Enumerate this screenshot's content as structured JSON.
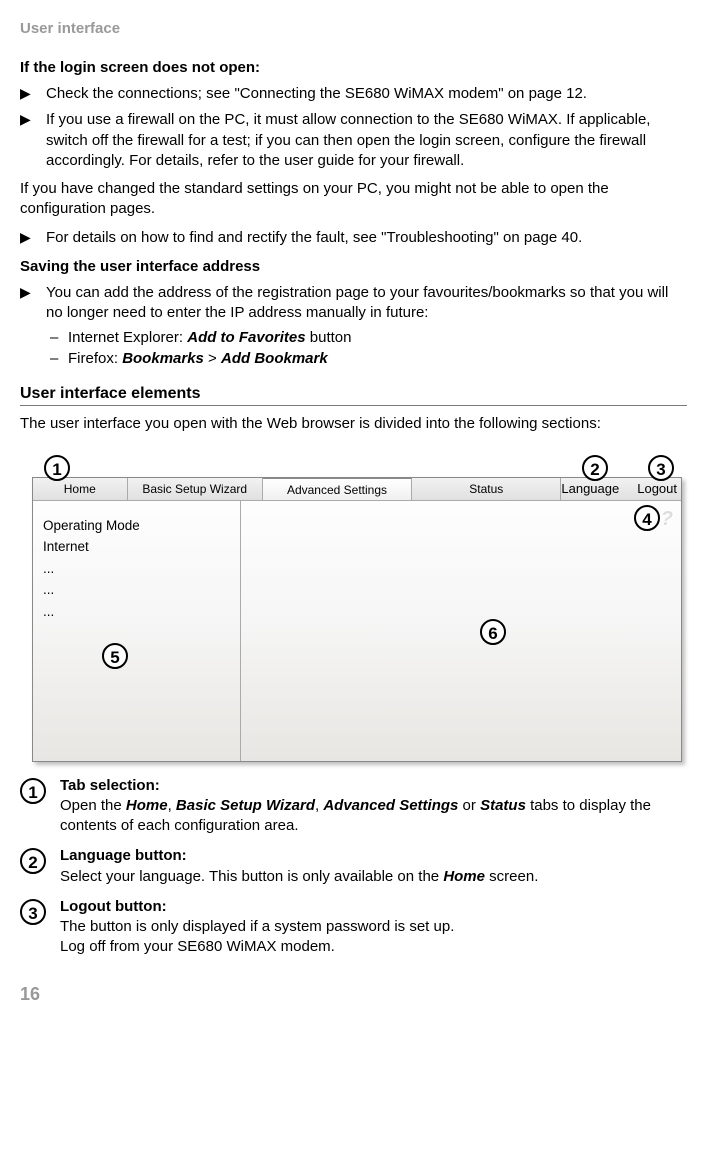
{
  "header_label": "User interface",
  "sec1_title": "If the login screen does not open:",
  "b1": "Check the connections; see \"Connecting the SE680 WiMAX modem\" on page 12.",
  "b2": "If you use a firewall on the PC, it must allow connection to the SE680 WiMAX. If applicable, switch off the firewall for a test; if you can then open the login screen, configure the firewall accordingly. For details, refer to the user guide for your firewall.",
  "p1": "If you have changed the standard settings on your PC, you might not be able to open the configuration pages.",
  "b3": "For details on how to find and rectify the fault, see \"Troubleshooting\" on page 40.",
  "sec2_title": "Saving the user interface address",
  "b4": "You can add the address of the registration page to your favourites/bookmarks so that you will no longer need to enter the IP address manually in future:",
  "d1_pre": "Internet Explorer: ",
  "d1_em": "Add to Favorites",
  "d1_post": " button",
  "d2_pre": "Firefox: ",
  "d2_em1": "Bookmarks",
  "d2_mid": " > ",
  "d2_em2": "Add Bookmark",
  "h2": "User interface elements",
  "p2": "The user interface you open with the Web browser is divided into the following sections:",
  "diagram": {
    "tabs": {
      "home": "Home",
      "wizard": "Basic Setup Wizard",
      "advanced": "Advanced Settings",
      "status": "Status"
    },
    "language": "Language",
    "logout": "Logout",
    "side": {
      "l1": "Operating Mode",
      "l2": "Internet",
      "l3": "...",
      "l4": "...",
      "l5": "..."
    },
    "help": "?",
    "marks": {
      "m1": "1",
      "m2": "2",
      "m3": "3",
      "m4": "4",
      "m5": "5",
      "m6": "6"
    }
  },
  "legend": {
    "l1_num": "1",
    "l1_title": "Tab selection:",
    "l1_a": "Open the ",
    "l1_home": "Home",
    "l1_b": ", ",
    "l1_wiz": "Basic Setup Wizard",
    "l1_c": ", ",
    "l1_adv": "Advanced Settings",
    "l1_d": " or ",
    "l1_stat": "Status",
    "l1_e": " tabs to display the contents of each configuration area.",
    "l2_num": "2",
    "l2_title": "Language button:",
    "l2_a": "Select your language. This button is only available on the ",
    "l2_home": "Home",
    "l2_b": " screen.",
    "l3_num": "3",
    "l3_title": "Logout button:",
    "l3_a": "The button is only displayed if a system password is set up.",
    "l3_b": "Log off from your SE680 WiMAX modem."
  },
  "pagenum": "16"
}
